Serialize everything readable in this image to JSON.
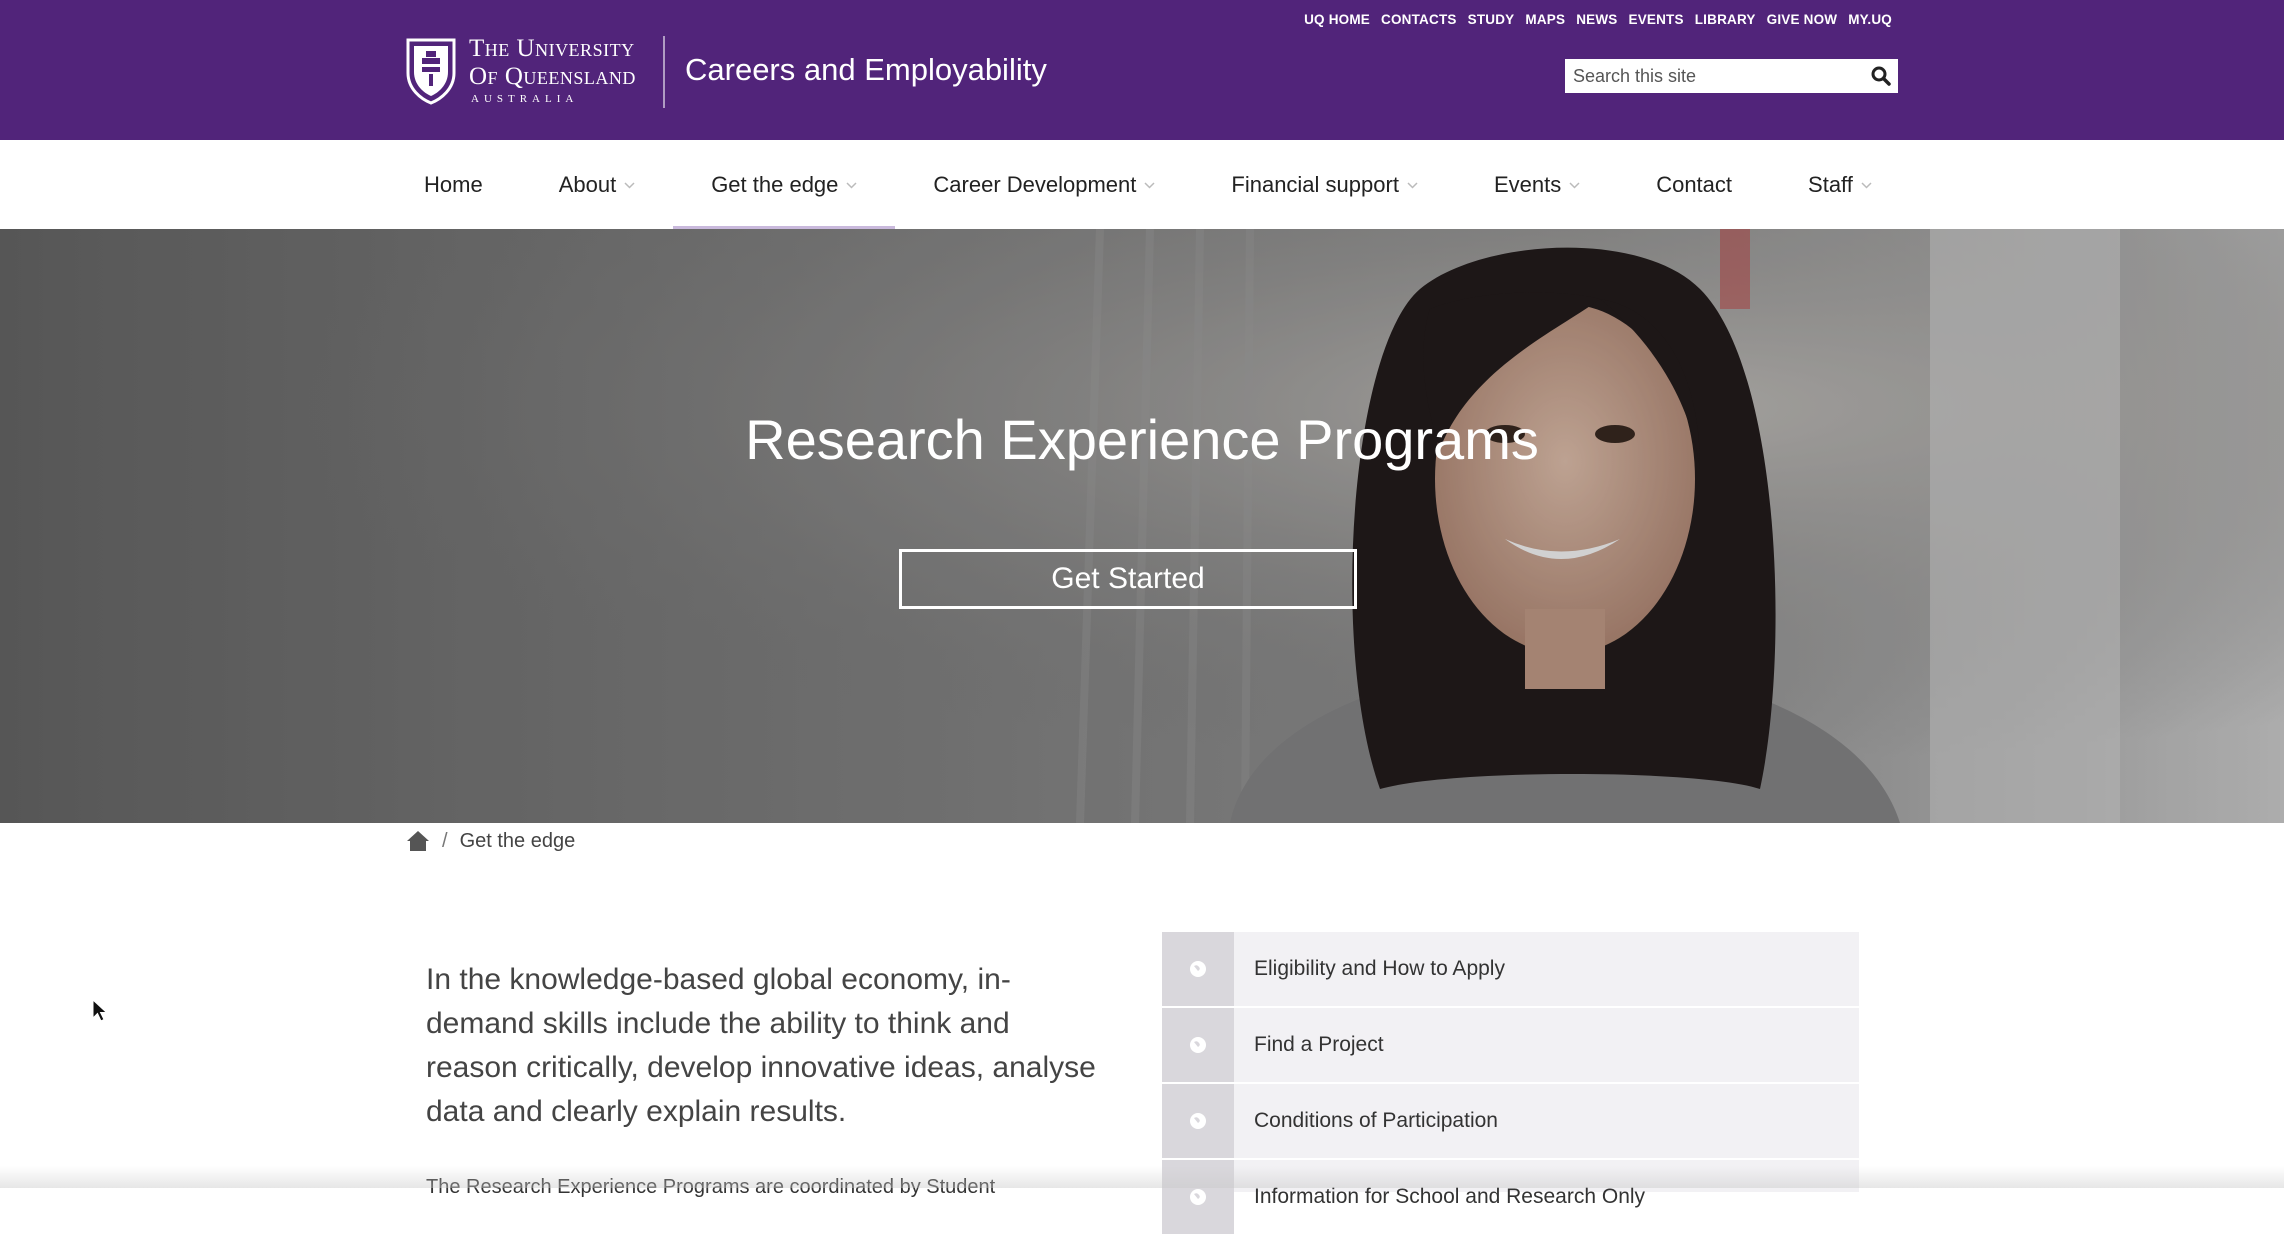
{
  "header": {
    "logo": {
      "line1": "The University",
      "line2": "Of Queensland",
      "line3": "AUSTRALIA"
    },
    "site_title": "Careers and Employability",
    "utility_links": [
      "UQ HOME",
      "CONTACTS",
      "STUDY",
      "MAPS",
      "NEWS",
      "EVENTS",
      "LIBRARY",
      "GIVE NOW",
      "MY.UQ"
    ],
    "search": {
      "placeholder": "Search this site",
      "value": ""
    },
    "brand_color": "#51247a"
  },
  "nav": {
    "items": [
      {
        "label": "Home",
        "has_dropdown": false
      },
      {
        "label": "About",
        "has_dropdown": true
      },
      {
        "label": "Get the edge",
        "has_dropdown": true,
        "active": true
      },
      {
        "label": "Career Development",
        "has_dropdown": true
      },
      {
        "label": "Financial support",
        "has_dropdown": true
      },
      {
        "label": "Events",
        "has_dropdown": true
      },
      {
        "label": "Contact",
        "has_dropdown": false
      },
      {
        "label": "Staff",
        "has_dropdown": true
      }
    ]
  },
  "hero": {
    "title": "Research Experience Programs",
    "button_label": "Get Started"
  },
  "breadcrumb": {
    "separator": "/",
    "current": "Get the edge"
  },
  "intro": {
    "text": "In the knowledge-based global economy, in-demand skills include the ability to think and reason critically, develop innovative ideas, analyse data and clearly explain results.",
    "second_line": "The Research Experience Programs are coordinated by Student"
  },
  "side_menu": {
    "items": [
      {
        "label": "Eligibility and How to Apply"
      },
      {
        "label": "Find a Project"
      },
      {
        "label": "Conditions of Participation"
      },
      {
        "label": "Information for School and Research Only"
      }
    ]
  }
}
